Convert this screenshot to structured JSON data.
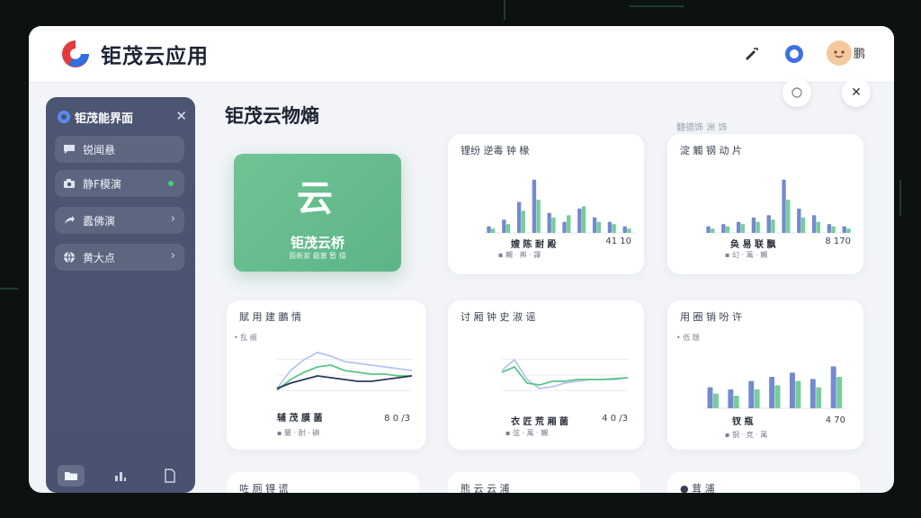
{
  "header": {
    "app_title": "钜茂云应用",
    "user_name": "鹏"
  },
  "sidebar": {
    "title": "钜茂能界面",
    "items": [
      {
        "label": "锐闻悬",
        "icon": "chat-icon"
      },
      {
        "label": "静F模演",
        "icon": "camera-icon",
        "status": "online"
      },
      {
        "label": "蠹佛演",
        "icon": "share-icon"
      },
      {
        "label": "黄大点",
        "icon": "globe-icon"
      }
    ]
  },
  "main": {
    "section_title": "钜茂云物熵",
    "top_caption": "髓德饰 洲 饰",
    "hero": {
      "mark": "云",
      "title": "钜茂云桥",
      "subtitle": "面新家 最塞 暂 描"
    },
    "cards": [
      {
        "id": "c1",
        "title": "锂纷 逆毒 钟 椽",
        "caption": "嫂 陈 耐 殿",
        "value": "41 10",
        "legend": "▪ 觸 · 輿 · 譯"
      },
      {
        "id": "c2",
        "title": "淀 觸 钢 动 片",
        "caption": "奂 易 联 飘",
        "value": "8 170",
        "legend": "▪ 幻 · 萬 · 觸"
      },
      {
        "id": "c3",
        "title": "賦 用 建 鵬 情",
        "caption": "辅 茂 膜 菌",
        "value": "8 0 /3",
        "legend": "▪ 蘭 · 耐 · 碘",
        "legend_top": "• 乱 纲"
      },
      {
        "id": "c4",
        "title": "讨 厢 钟 史 淑 谣",
        "caption": "衣 匠 荒 厢 菌",
        "value": "4 0 /3",
        "legend": "▪ 弦 · 萬 · 觸"
      },
      {
        "id": "c5",
        "title": "用 圈 销 吩 许",
        "caption": "钗 瓶",
        "value": "4 70",
        "legend": "▪ 钢 · 竞 · 萬",
        "legend_top": "• 低 题"
      }
    ],
    "partial_cards": [
      {
        "title": "咗 厕 锝 谎"
      },
      {
        "title": "熊 云 云 浦"
      },
      {
        "title": "● 茸 浦"
      }
    ]
  },
  "colors": {
    "accent_green": "#5db487",
    "sidebar_bg": "#4a5470",
    "chart_blue": "#5b76c8",
    "chart_green": "#5ec48a",
    "chart_light": "#b7c4ef"
  },
  "chart_data": [
    {
      "type": "bar",
      "title": "锂纷 逆毒 钟 椽",
      "categories": [
        "1",
        "2",
        "3",
        "4",
        "5",
        "6",
        "7",
        "8",
        "9",
        "10"
      ],
      "series": [
        {
          "values": [
            6,
            12,
            28,
            48,
            18,
            10,
            22,
            14,
            10,
            6
          ]
        },
        {
          "values": [
            4,
            8,
            20,
            30,
            14,
            16,
            24,
            10,
            8,
            4
          ]
        }
      ],
      "ylim": [
        0,
        60
      ]
    },
    {
      "type": "bar",
      "title": "淀 觸 钢 动 片",
      "categories": [
        "1",
        "2",
        "3",
        "4",
        "5",
        "6",
        "7",
        "8",
        "9",
        "10"
      ],
      "series": [
        {
          "values": [
            6,
            8,
            10,
            14,
            16,
            48,
            22,
            16,
            8,
            6
          ]
        },
        {
          "values": [
            4,
            6,
            8,
            10,
            12,
            30,
            14,
            10,
            6,
            4
          ]
        }
      ],
      "ylim": [
        0,
        60
      ]
    },
    {
      "type": "line",
      "title": "賦 用 建 鵬 情",
      "x": [
        0,
        1,
        2,
        3,
        4,
        5,
        6,
        7,
        8,
        9,
        10
      ],
      "series": [
        {
          "values": [
            20,
            40,
            52,
            60,
            56,
            50,
            48,
            46,
            44,
            42,
            40
          ]
        },
        {
          "values": [
            18,
            30,
            38,
            44,
            46,
            40,
            38,
            36,
            36,
            34,
            34
          ]
        },
        {
          "values": [
            20,
            26,
            30,
            34,
            32,
            30,
            28,
            28,
            30,
            32,
            34
          ]
        }
      ],
      "ylim": [
        0,
        70
      ]
    },
    {
      "type": "line",
      "title": "讨 厢 钟 史 淑 谣",
      "x": [
        0,
        1,
        2,
        3,
        4,
        5,
        6,
        7,
        8,
        9,
        10
      ],
      "series": [
        {
          "values": [
            40,
            52,
            30,
            20,
            22,
            26,
            28,
            30,
            30,
            30,
            32
          ]
        },
        {
          "values": [
            38,
            44,
            26,
            24,
            28,
            28,
            30,
            30,
            30,
            31,
            32
          ]
        }
      ],
      "ylim": [
        0,
        70
      ]
    },
    {
      "type": "bar",
      "title": "用 圈 销 吩 许",
      "categories": [
        "1",
        "2",
        "3",
        "4",
        "5",
        "6",
        "7"
      ],
      "series": [
        {
          "values": [
            20,
            18,
            26,
            30,
            34,
            28,
            40
          ]
        },
        {
          "values": [
            14,
            12,
            18,
            22,
            26,
            20,
            30
          ]
        }
      ],
      "ylim": [
        0,
        60
      ]
    }
  ]
}
